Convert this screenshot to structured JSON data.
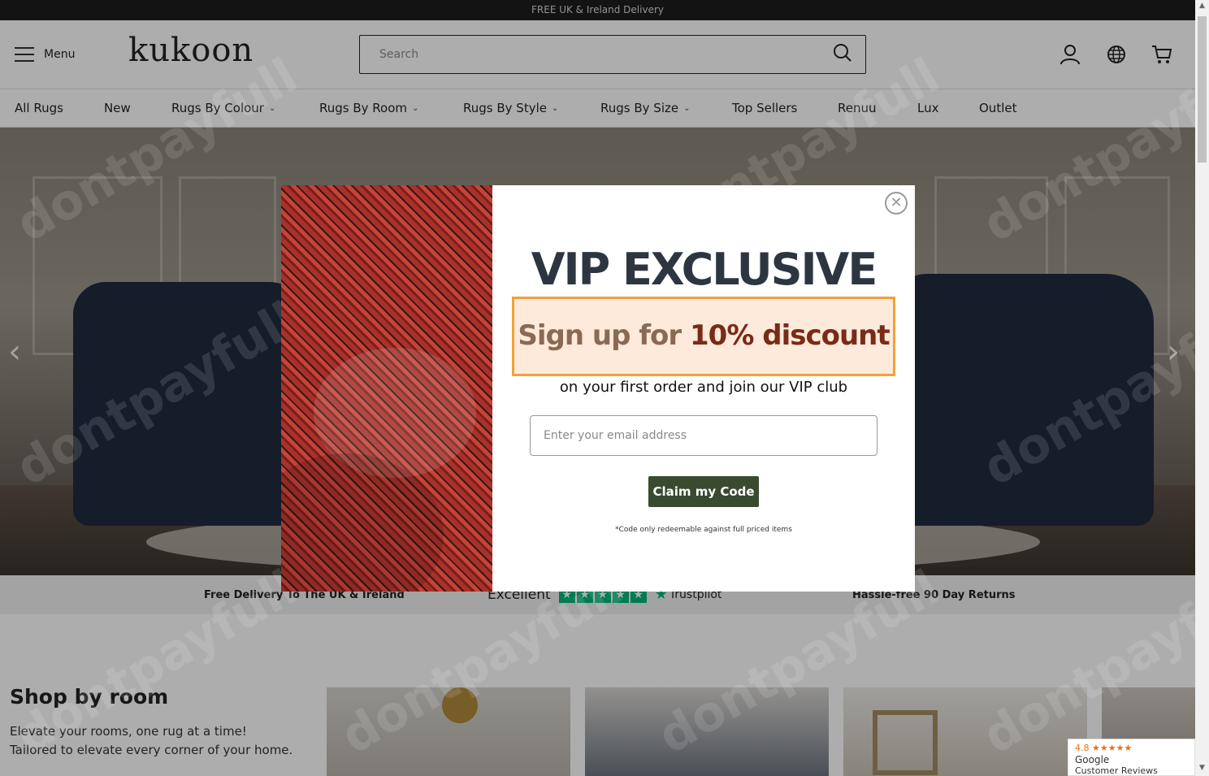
{
  "topbar": {
    "text": "FREE UK & Ireland Delivery"
  },
  "header": {
    "menu_label": "Menu",
    "logo": "kukoon",
    "search_placeholder": "Search"
  },
  "nav": {
    "items": [
      {
        "label": "All Rugs",
        "dropdown": false
      },
      {
        "label": "New",
        "dropdown": false
      },
      {
        "label": "Rugs By Colour",
        "dropdown": true
      },
      {
        "label": "Rugs By Room",
        "dropdown": true
      },
      {
        "label": "Rugs By Style",
        "dropdown": true
      },
      {
        "label": "Rugs By Size",
        "dropdown": true
      },
      {
        "label": "Top Sellers",
        "dropdown": false
      },
      {
        "label": "Renuu",
        "dropdown": false
      },
      {
        "label": "Lux",
        "dropdown": false
      },
      {
        "label": "Outlet",
        "dropdown": false
      }
    ]
  },
  "usp": {
    "delivery": "Free Delivery To The UK & Ireland",
    "trustpilot_rating": "Excellent",
    "trustpilot_brand": "Trustpilot",
    "returns": "Hassle-free 90 Day Returns"
  },
  "shop": {
    "title": "Shop by room",
    "line1": "Elevate your rooms, one rug at a time!",
    "line2": "Tailored to elevate every corner of your home."
  },
  "modal": {
    "title": "VIP EXCLUSIVE",
    "signup_prefix": "Sign up for ",
    "signup_strong": "10% discount",
    "subtitle": "on your first order and join our VIP club",
    "email_placeholder": "Enter your email address",
    "button": "Claim my Code",
    "note": "*Code only redeemable against full priced items"
  },
  "google_badge": {
    "rating": "4.8",
    "stars": "★★★★★",
    "brand": "Google",
    "label": "Customer Reviews"
  },
  "colors": {
    "accent_green": "#3a4a2f",
    "highlight_border": "#f0a23a",
    "trustpilot_green": "#00b67a"
  }
}
